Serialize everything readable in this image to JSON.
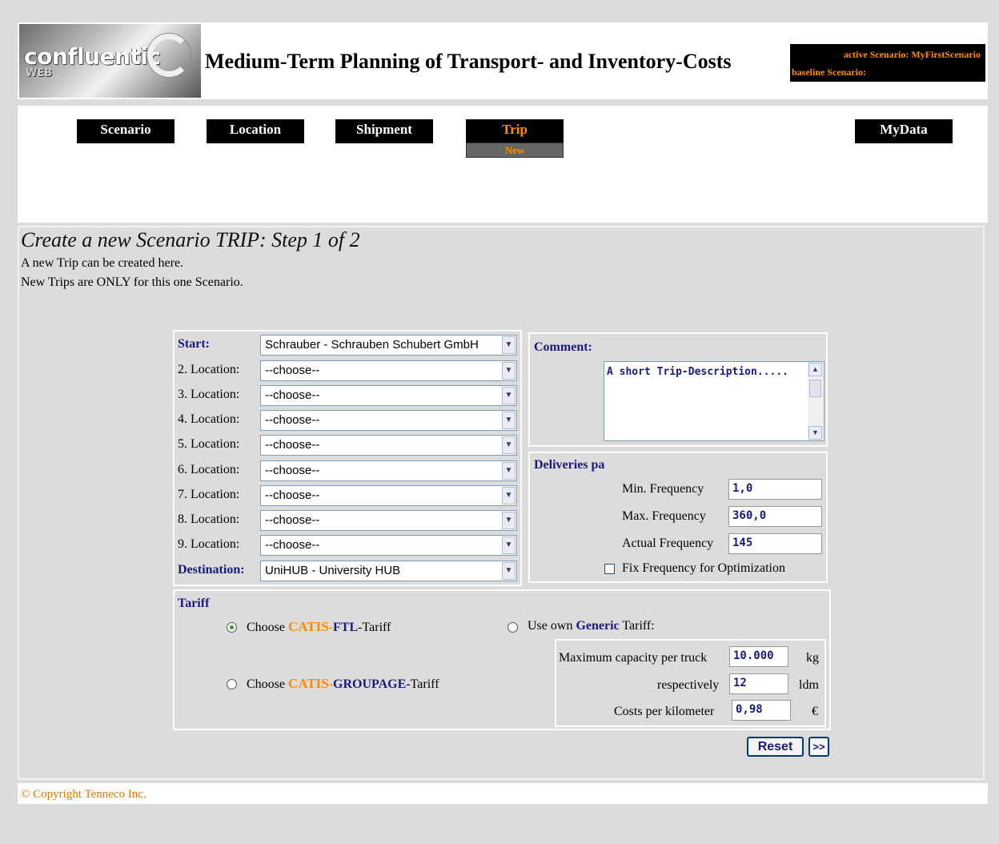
{
  "header": {
    "logo_brand": "confluentic",
    "logo_sub": "WEB",
    "title": "Medium-Term Planning of Transport- and Inventory-Costs",
    "active_scenario": "active Scenario: MyFirstScenario",
    "baseline_scenario": "baseline Scenario:"
  },
  "nav": {
    "items": [
      {
        "label": "Scenario",
        "active": false
      },
      {
        "label": "Location",
        "active": false
      },
      {
        "label": "Shipment",
        "active": false
      },
      {
        "label": "Trip",
        "active": true
      },
      {
        "label": "MyData",
        "active": false
      }
    ],
    "sub_item": "New"
  },
  "page": {
    "title": "Create a new Scenario TRIP: Step 1 of 2",
    "intro1": "A new Trip can be created here.",
    "intro2": "New Trips are ONLY for this one Scenario."
  },
  "route": {
    "start_label": "Start:",
    "start_value": "Schrauber - Schrauben Schubert GmbH",
    "locations": [
      {
        "label": "2. Location:",
        "value": "--choose--"
      },
      {
        "label": "3. Location:",
        "value": "--choose--"
      },
      {
        "label": "4. Location:",
        "value": "--choose--"
      },
      {
        "label": "5. Location:",
        "value": "--choose--"
      },
      {
        "label": "6. Location:",
        "value": "--choose--"
      },
      {
        "label": "7. Location:",
        "value": "--choose--"
      },
      {
        "label": "8. Location:",
        "value": "--choose--"
      },
      {
        "label": "9. Location:",
        "value": "--choose--"
      }
    ],
    "destination_label": "Destination:",
    "destination_value": "UniHUB - University HUB"
  },
  "comment": {
    "label": "Comment:",
    "text": "A short Trip-Description....."
  },
  "deliveries": {
    "heading": "Deliveries pa",
    "min_label": "Min. Frequency",
    "min_value": "1,0",
    "max_label": "Max. Frequency",
    "max_value": "360,0",
    "actual_label": "Actual Frequency",
    "actual_value": "145",
    "fix_label": "Fix Frequency for Optimization"
  },
  "tariff": {
    "heading": "Tariff",
    "ftl": {
      "pre": "Choose ",
      "catis": "CATIS",
      "dash": "-",
      "name": "FTL",
      "post": "-Tariff"
    },
    "groupage": {
      "pre": "Choose ",
      "catis": "CATIS",
      "dash": "-",
      "name": "GROUPAGE",
      "post": "-Tariff"
    },
    "generic": {
      "pre": "Use own ",
      "name": "Generic",
      "post": " Tariff:"
    },
    "max_capacity_label": "Maximum capacity per truck",
    "max_capacity_value": "10.000",
    "max_capacity_unit": "kg",
    "respectively_label": "respectively",
    "respectively_value": "12",
    "respectively_unit": "ldm",
    "cost_label": "Costs per kilometer",
    "cost_value": "0,98",
    "cost_unit": "€"
  },
  "actions": {
    "reset": "Reset",
    "next": ">>"
  },
  "footer": {
    "copyright": "© Copyright Tenneco Inc."
  }
}
